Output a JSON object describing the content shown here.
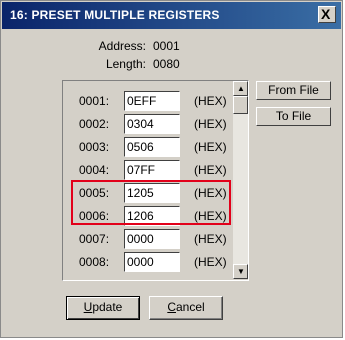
{
  "window": {
    "title": "16: PRESET MULTIPLE REGISTERS",
    "close_label": "X"
  },
  "info": {
    "address_label": "Address:",
    "address_value": "0001",
    "length_label": "Length:",
    "length_value": "0080"
  },
  "registers": [
    {
      "address": "0001:",
      "value": "0EFF",
      "format": "(HEX)"
    },
    {
      "address": "0002:",
      "value": "0304",
      "format": "(HEX)"
    },
    {
      "address": "0003:",
      "value": "0506",
      "format": "(HEX)"
    },
    {
      "address": "0004:",
      "value": "07FF",
      "format": "(HEX)"
    },
    {
      "address": "0005:",
      "value": "1205",
      "format": "(HEX)"
    },
    {
      "address": "0006:",
      "value": "1206",
      "format": "(HEX)"
    },
    {
      "address": "0007:",
      "value": "0000",
      "format": "(HEX)"
    },
    {
      "address": "0008:",
      "value": "0000",
      "format": "(HEX)"
    }
  ],
  "buttons": {
    "from_file": "From File",
    "to_file": "To File",
    "update_prefix": "U",
    "update_rest": "pdate",
    "cancel_prefix": "C",
    "cancel_rest": "ancel"
  },
  "highlight_color": "#e2001a"
}
